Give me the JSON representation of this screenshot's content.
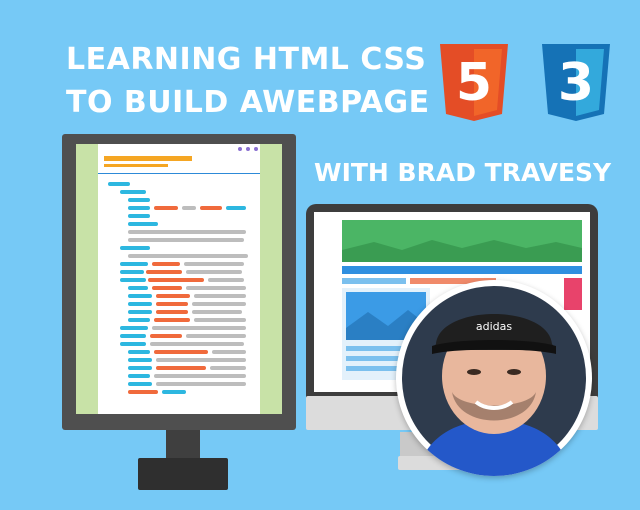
{
  "headline": {
    "line1": "LEARNING HTML CSS",
    "line2": "TO BUILD AWEBPAGE"
  },
  "subtitle": "WITH BRAD TRAVESY",
  "logos": {
    "html5": {
      "digit": "5",
      "color": "#e44d26",
      "dark": "#c23a1c"
    },
    "css3": {
      "digit": "3",
      "color": "#1e88d6",
      "dark": "#1764a8"
    }
  },
  "avatar": {
    "cap_text": "adidas"
  },
  "colors": {
    "background": "#76c9f6",
    "monitor": "#4f4f4f",
    "editor_sidebar": "#c8e2a7",
    "code_blue": "#2db7e0",
    "code_orange": "#f06a3c",
    "code_grey": "#bdbdbd",
    "site_green": "#4bb565",
    "site_blue": "#2f8fe0"
  }
}
